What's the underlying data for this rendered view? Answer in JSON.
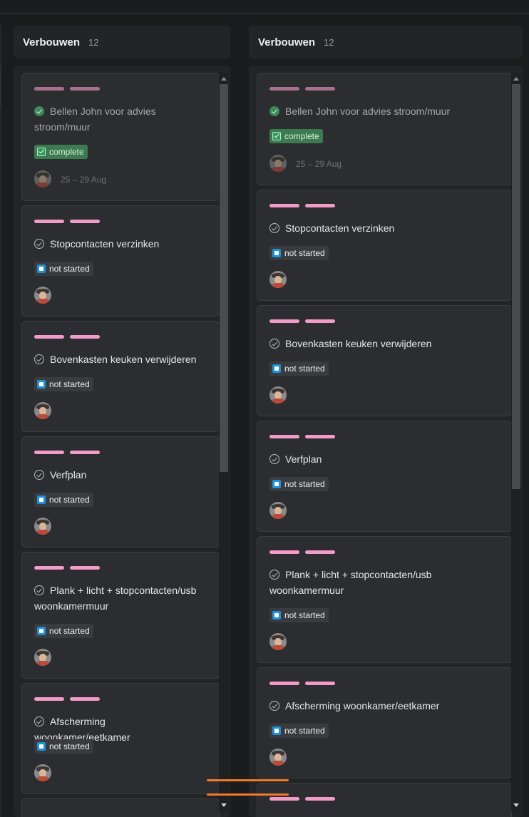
{
  "columns": [
    {
      "title": "Verbouwen",
      "count": "12",
      "cards": [
        {
          "title": "Bellen John voor advies stroom/muur",
          "status": "complete",
          "date": "25 – 29 Aug"
        },
        {
          "title": "Stopcontacten verzinken",
          "status": "not started"
        },
        {
          "title": "Bovenkasten keuken verwijderen",
          "status": "not started"
        },
        {
          "title": "Verfplan",
          "status": "not started"
        },
        {
          "title": "Plank + licht + stopcontacten/usb woonkamermuur",
          "status": "not started"
        },
        {
          "title": "Afscherming woonkamer/eetkamer",
          "status": "not started"
        }
      ]
    },
    {
      "title": "Verbouwen",
      "count": "12",
      "cards": [
        {
          "title": "Bellen John voor advies stroom/muur",
          "status": "complete",
          "date": "25 – 29 Aug"
        },
        {
          "title": "Stopcontacten verzinken",
          "status": "not started"
        },
        {
          "title": "Bovenkasten keuken verwijderen",
          "status": "not started"
        },
        {
          "title": "Verfplan",
          "status": "not started"
        },
        {
          "title": "Plank + licht + stopcontacten/usb woonkamermuur",
          "status": "not started"
        },
        {
          "title": "Afscherming woonkamer/eetkamer",
          "status": "not started"
        }
      ]
    }
  ],
  "colors": {
    "label": "#f29bc8",
    "complete": "#3c7a50",
    "not_started_icon": "#1e90d6",
    "drop_indicator": "#f07a2a"
  },
  "icons": {
    "task": "check-circle-icon",
    "complete": "checkbox-checked-icon",
    "not_started": "stop-square-icon"
  }
}
